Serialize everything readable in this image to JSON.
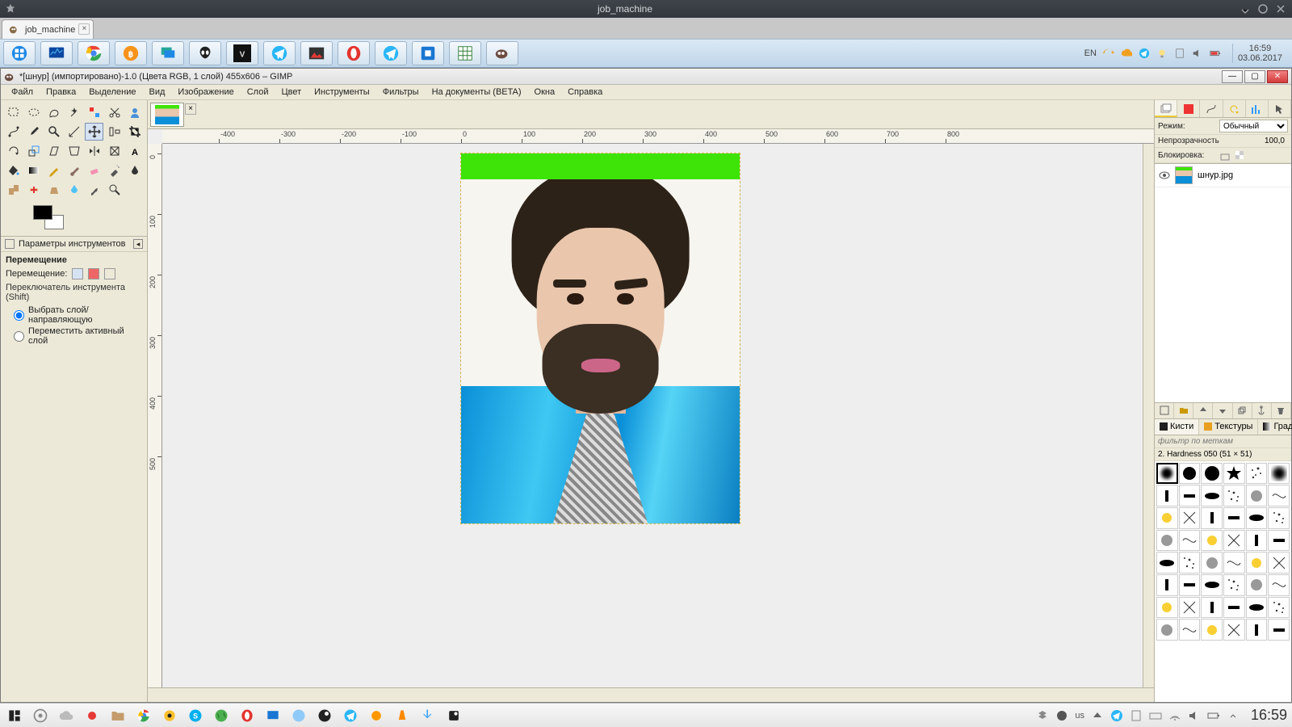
{
  "kde": {
    "title": "job_machine"
  },
  "browser_tab": {
    "label": "job_machine"
  },
  "top_tray": {
    "lang": "EN",
    "clock_time": "16:59",
    "clock_date": "03.06.2017"
  },
  "gimp": {
    "title": "*[шнур] (импортировано)-1.0 (Цвета RGB, 1 слой) 455x606 – GIMP",
    "menus": [
      "Файл",
      "Правка",
      "Выделение",
      "Вид",
      "Изображение",
      "Слой",
      "Цвет",
      "Инструменты",
      "Фильтры",
      "На документы (BETA)",
      "Окна",
      "Справка"
    ],
    "tool_options": {
      "header": "Параметры инструментов",
      "title": "Перемещение",
      "move_label": "Перемещение:",
      "switch_label": "Переключатель инструмента  (Shift)",
      "opt_pick": "Выбрать слой/направляющую",
      "opt_active": "Переместить активный слой"
    },
    "ruler_h": [
      "-400",
      "-300",
      "-200",
      "-100",
      "0",
      "100",
      "200",
      "300",
      "400",
      "500",
      "600",
      "700",
      "800"
    ],
    "ruler_v": [
      "0",
      "100",
      "200",
      "300",
      "400",
      "500"
    ],
    "right": {
      "mode_label": "Режим:",
      "mode_value": "Обычный",
      "opacity_label": "Непрозрачность",
      "opacity_value": "100,0",
      "lock_label": "Блокировка:",
      "layer_name": "шнур.jpg"
    },
    "brush": {
      "tabs": [
        "Кисти",
        "Текстуры",
        "Градиенты"
      ],
      "filter_placeholder": "фильтр по меткам",
      "selected": "2. Hardness 050 (51 × 51)"
    }
  },
  "bottom": {
    "lang": "us",
    "clock": "16:59"
  }
}
